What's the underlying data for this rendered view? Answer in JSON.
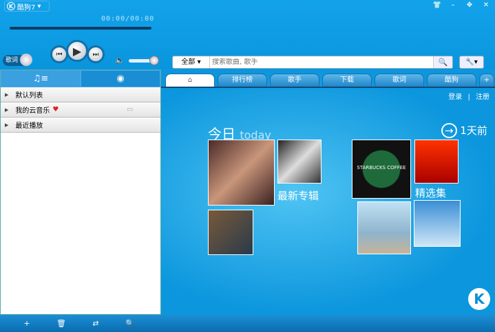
{
  "app": {
    "title": "酷狗7",
    "time": "00:00/00:00"
  },
  "player": {
    "lyrics_toggle": "歌词",
    "progress": 0,
    "volume": 1.0
  },
  "search": {
    "category": "全部",
    "placeholder": "搜索歌曲, 歌手"
  },
  "left_tabs": [
    "music-list",
    "radio"
  ],
  "playlists": [
    {
      "label": "默认列表"
    },
    {
      "label": "我的云音乐"
    },
    {
      "label": "最近播放"
    }
  ],
  "tabs": [
    "排行榜",
    "歌手",
    "下载",
    "歌词",
    "酷狗"
  ],
  "auth": {
    "login": "登录",
    "sep": "|",
    "register": "注册"
  },
  "content": {
    "today": "今日",
    "today_en": "today",
    "prev": "1天前",
    "new_albums": "最新专辑",
    "featured": "精选集",
    "starbucks": "STARBUCKS COFFEE"
  }
}
